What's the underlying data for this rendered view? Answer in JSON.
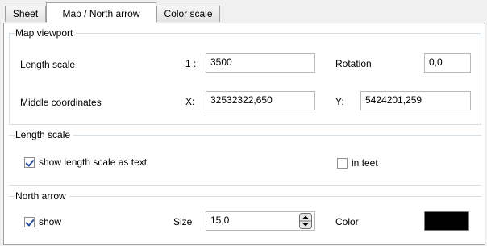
{
  "tabs": [
    {
      "label": "Sheet"
    },
    {
      "label": "Map / North arrow"
    },
    {
      "label": "Color scale"
    }
  ],
  "viewport": {
    "title": "Map viewport",
    "length_scale_label": "Length scale",
    "scale_prefix": "1 :",
    "scale_value": "3500",
    "rotation_label": "Rotation",
    "rotation_value": "0,0",
    "middle_label": "Middle coordinates",
    "x_label": "X:",
    "x_value": "32532322,650",
    "y_label": "Y:",
    "y_value": "5424201,259"
  },
  "length_scale": {
    "title": "Length scale",
    "show_text_label": "show length scale as text",
    "show_text_checked": true,
    "in_feet_label": "in feet",
    "in_feet_checked": false
  },
  "north_arrow": {
    "title": "North arrow",
    "show_label": "show",
    "show_checked": true,
    "size_label": "Size",
    "size_value": "15,0",
    "color_label": "Color",
    "color_value": "#000000"
  }
}
